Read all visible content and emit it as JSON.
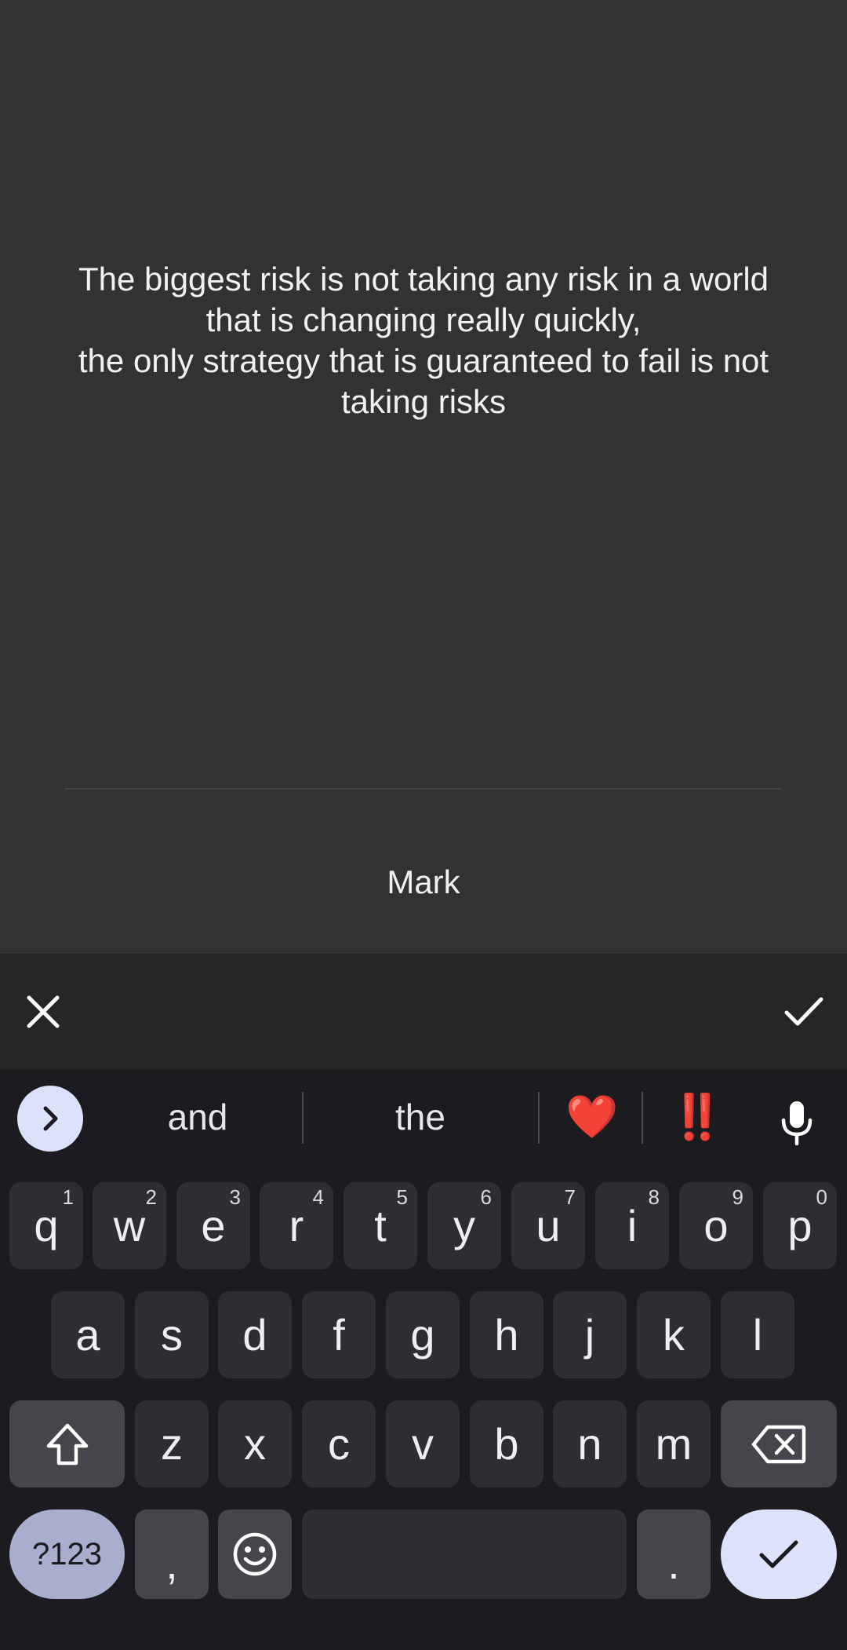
{
  "editor": {
    "quote": "The biggest risk is not taking any risk in a world\nthat is changing really quickly,\nthe only strategy that is guaranteed to fail is not\ntaking risks",
    "author": "Mark"
  },
  "action_bar": {
    "cancel_icon": "close-icon",
    "confirm_icon": "check-icon"
  },
  "keyboard": {
    "suggestions": [
      "and",
      "the",
      "❤️",
      "‼️"
    ],
    "row1": [
      {
        "key": "q",
        "hint": "1"
      },
      {
        "key": "w",
        "hint": "2"
      },
      {
        "key": "e",
        "hint": "3"
      },
      {
        "key": "r",
        "hint": "4"
      },
      {
        "key": "t",
        "hint": "5"
      },
      {
        "key": "y",
        "hint": "6"
      },
      {
        "key": "u",
        "hint": "7"
      },
      {
        "key": "i",
        "hint": "8"
      },
      {
        "key": "o",
        "hint": "9"
      },
      {
        "key": "p",
        "hint": "0"
      }
    ],
    "row2": [
      "a",
      "s",
      "d",
      "f",
      "g",
      "h",
      "j",
      "k",
      "l"
    ],
    "row3": [
      "z",
      "x",
      "c",
      "v",
      "b",
      "n",
      "m"
    ],
    "symbols_label": "?123",
    "comma": ",",
    "period": ".",
    "colors": {
      "background": "#1c1b20",
      "key": "#2e2d33",
      "function_key": "#46454c",
      "accent": "#dce2fb",
      "symbols_key": "#a8aecd"
    }
  }
}
